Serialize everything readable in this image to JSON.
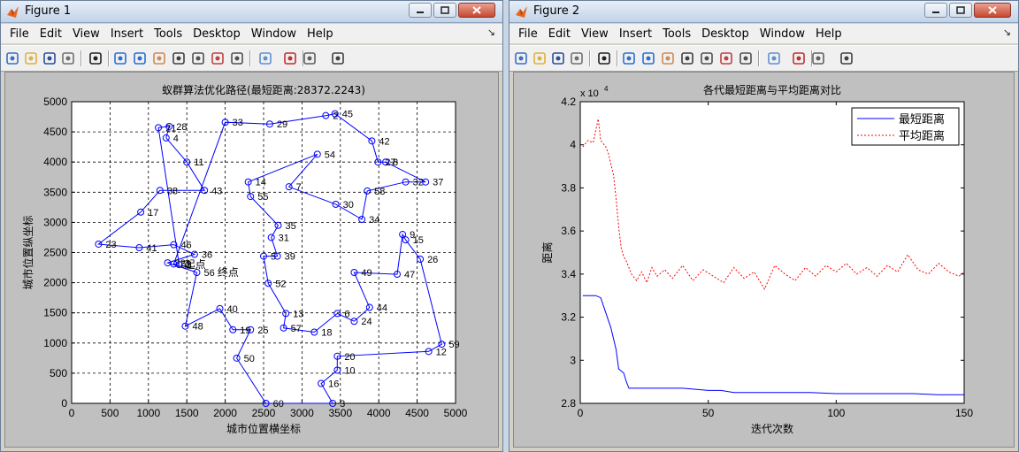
{
  "colors": {
    "route": "#0000ff",
    "best_line": "#0000ff",
    "avg_line": "#ff0000",
    "figure_bg": "#c0c0c0",
    "axes_bg": "#ffffff"
  },
  "menu": [
    "File",
    "Edit",
    "View",
    "Insert",
    "Tools",
    "Desktop",
    "Window",
    "Help"
  ],
  "toolbar_icons": [
    "new-icon",
    "open-icon",
    "save-icon",
    "print-icon",
    "pointer-icon",
    "zoom-in-icon",
    "zoom-out-icon",
    "pan-icon",
    "rotate-icon",
    "data-cursor-icon",
    "brush-icon",
    "link-icon",
    "colorbar-icon",
    "legend-icon",
    "hide-tools-icon",
    "dock-icon"
  ],
  "windows": [
    {
      "title": "Figure 1"
    },
    {
      "title": "Figure 2"
    }
  ],
  "chart_data": [
    {
      "type": "scatter",
      "title": "蚁群算法优化路径(最短距离:28372.2243)",
      "xlabel": "城市位置横坐标",
      "ylabel": "城市位置纵坐标",
      "xlim": [
        0,
        5000
      ],
      "ylim": [
        0,
        5000
      ],
      "xticks": [
        "0",
        "500",
        "1000",
        "1500",
        "2000",
        "2500",
        "3000",
        "3500",
        "4000",
        "4500",
        "5000"
      ],
      "yticks": [
        "0",
        "500",
        "1000",
        "1500",
        "2000",
        "2500",
        "3000",
        "3500",
        "4000",
        "4500",
        "5000"
      ],
      "grid": true,
      "start_label": "起点",
      "end_label": "终点",
      "start_point": [
        1470,
        2300
      ],
      "end_point": [
        1900,
        2170
      ],
      "points": [
        {
          "label": "21",
          "x": 1130,
          "y": 4570
        },
        {
          "label": "28",
          "x": 1270,
          "y": 4590
        },
        {
          "label": "4",
          "x": 1230,
          "y": 4400
        },
        {
          "label": "11",
          "x": 1500,
          "y": 4000
        },
        {
          "label": "43",
          "x": 1730,
          "y": 3530
        },
        {
          "label": "38",
          "x": 1150,
          "y": 3530
        },
        {
          "label": "17",
          "x": 900,
          "y": 3170
        },
        {
          "label": "23",
          "x": 350,
          "y": 2640
        },
        {
          "label": "41",
          "x": 880,
          "y": 2580
        },
        {
          "label": "46",
          "x": 1330,
          "y": 2630
        },
        {
          "label": "36",
          "x": 1600,
          "y": 2470
        },
        {
          "label": "22",
          "x": 1250,
          "y": 2330
        },
        {
          "label": "56",
          "x": 1630,
          "y": 2170
        },
        {
          "label": "48",
          "x": 1480,
          "y": 1280
        },
        {
          "label": "40",
          "x": 1930,
          "y": 1570
        },
        {
          "label": "19",
          "x": 2100,
          "y": 1220
        },
        {
          "label": "25",
          "x": 2330,
          "y": 1220
        },
        {
          "label": "50",
          "x": 2150,
          "y": 750
        },
        {
          "label": "60",
          "x": 2530,
          "y": 0
        },
        {
          "label": "3",
          "x": 3400,
          "y": 0
        },
        {
          "label": "16",
          "x": 3250,
          "y": 330
        },
        {
          "label": "10",
          "x": 3460,
          "y": 550
        },
        {
          "label": "20",
          "x": 3460,
          "y": 780
        },
        {
          "label": "12",
          "x": 4650,
          "y": 860
        },
        {
          "label": "59",
          "x": 4820,
          "y": 980
        },
        {
          "label": "26",
          "x": 4540,
          "y": 2390
        },
        {
          "label": "15",
          "x": 4350,
          "y": 2710
        },
        {
          "label": "9",
          "x": 4310,
          "y": 2800
        },
        {
          "label": "47",
          "x": 4240,
          "y": 2140
        },
        {
          "label": "49",
          "x": 3680,
          "y": 2170
        },
        {
          "label": "44",
          "x": 3880,
          "y": 1590
        },
        {
          "label": "24",
          "x": 3680,
          "y": 1360
        },
        {
          "label": "6",
          "x": 3460,
          "y": 1490
        },
        {
          "label": "18",
          "x": 3160,
          "y": 1180
        },
        {
          "label": "57",
          "x": 2760,
          "y": 1250
        },
        {
          "label": "13",
          "x": 2790,
          "y": 1490
        },
        {
          "label": "52",
          "x": 2560,
          "y": 1990
        },
        {
          "label": "5",
          "x": 2500,
          "y": 2440
        },
        {
          "label": "39",
          "x": 2680,
          "y": 2440
        },
        {
          "label": "31",
          "x": 2600,
          "y": 2750
        },
        {
          "label": "35",
          "x": 2690,
          "y": 2950
        },
        {
          "label": "55",
          "x": 2330,
          "y": 3430
        },
        {
          "label": "14",
          "x": 2300,
          "y": 3670
        },
        {
          "label": "54",
          "x": 3200,
          "y": 4130
        },
        {
          "label": "7",
          "x": 2830,
          "y": 3590
        },
        {
          "label": "30",
          "x": 3440,
          "y": 3300
        },
        {
          "label": "34",
          "x": 3780,
          "y": 3050
        },
        {
          "label": "58",
          "x": 3850,
          "y": 3520
        },
        {
          "label": "32",
          "x": 4350,
          "y": 3670
        },
        {
          "label": "37",
          "x": 4610,
          "y": 3670
        },
        {
          "label": "8",
          "x": 4090,
          "y": 4000
        },
        {
          "label": "27",
          "x": 3990,
          "y": 4000
        },
        {
          "label": "42",
          "x": 3910,
          "y": 4350
        },
        {
          "label": "45",
          "x": 3430,
          "y": 4800
        },
        {
          "label": "2",
          "x": 3310,
          "y": 4770
        },
        {
          "label": "29",
          "x": 2580,
          "y": 4630
        },
        {
          "label": "33",
          "x": 2000,
          "y": 4660
        },
        {
          "label": "53",
          "x": 1330,
          "y": 2310
        },
        {
          "label": "1",
          "x": 1400,
          "y": 2300
        }
      ]
    },
    {
      "type": "line",
      "title": "各代最短距离与平均距离对比",
      "xlabel": "迭代次数",
      "ylabel": "距离",
      "y_exponent": "x 10",
      "y_exponent_power": "4",
      "xlim": [
        0,
        150
      ],
      "ylim": [
        2.8,
        4.2
      ],
      "xticks": [
        "0",
        "50",
        "100",
        "150"
      ],
      "yticks": [
        "2.8",
        "3",
        "3.2",
        "3.4",
        "3.6",
        "3.8",
        "4",
        "4.2"
      ],
      "grid": false,
      "legend_position": "top-right",
      "series": [
        {
          "name": "最短距离",
          "x": [
            1,
            6,
            8,
            10,
            12,
            14,
            15,
            17,
            18,
            19,
            20,
            25,
            30,
            40,
            50,
            55,
            60,
            70,
            80,
            90,
            100,
            110,
            120,
            130,
            140,
            150
          ],
          "values": [
            3.3,
            3.3,
            3.29,
            3.22,
            3.15,
            3.05,
            2.96,
            2.94,
            2.9,
            2.87,
            2.87,
            2.87,
            2.87,
            2.87,
            2.86,
            2.86,
            2.85,
            2.85,
            2.85,
            2.85,
            2.845,
            2.845,
            2.845,
            2.845,
            2.84,
            2.84
          ]
        },
        {
          "name": "平均距离",
          "x": [
            1,
            3,
            5,
            7,
            8,
            10,
            11,
            13,
            14,
            15,
            16,
            17,
            18,
            20,
            22,
            24,
            26,
            28,
            30,
            33,
            36,
            40,
            44,
            48,
            52,
            56,
            60,
            64,
            68,
            72,
            76,
            80,
            84,
            88,
            92,
            96,
            100,
            104,
            108,
            112,
            116,
            120,
            124,
            128,
            132,
            136,
            140,
            144,
            148,
            150
          ],
          "values": [
            3.99,
            4.02,
            4.01,
            4.12,
            4.02,
            3.99,
            3.96,
            3.86,
            3.75,
            3.62,
            3.52,
            3.48,
            3.46,
            3.4,
            3.37,
            3.41,
            3.36,
            3.43,
            3.39,
            3.42,
            3.38,
            3.44,
            3.37,
            3.42,
            3.39,
            3.36,
            3.43,
            3.38,
            3.41,
            3.33,
            3.44,
            3.4,
            3.37,
            3.43,
            3.39,
            3.44,
            3.41,
            3.45,
            3.4,
            3.43,
            3.39,
            3.44,
            3.41,
            3.49,
            3.42,
            3.4,
            3.45,
            3.41,
            3.39,
            3.41
          ]
        }
      ]
    }
  ]
}
